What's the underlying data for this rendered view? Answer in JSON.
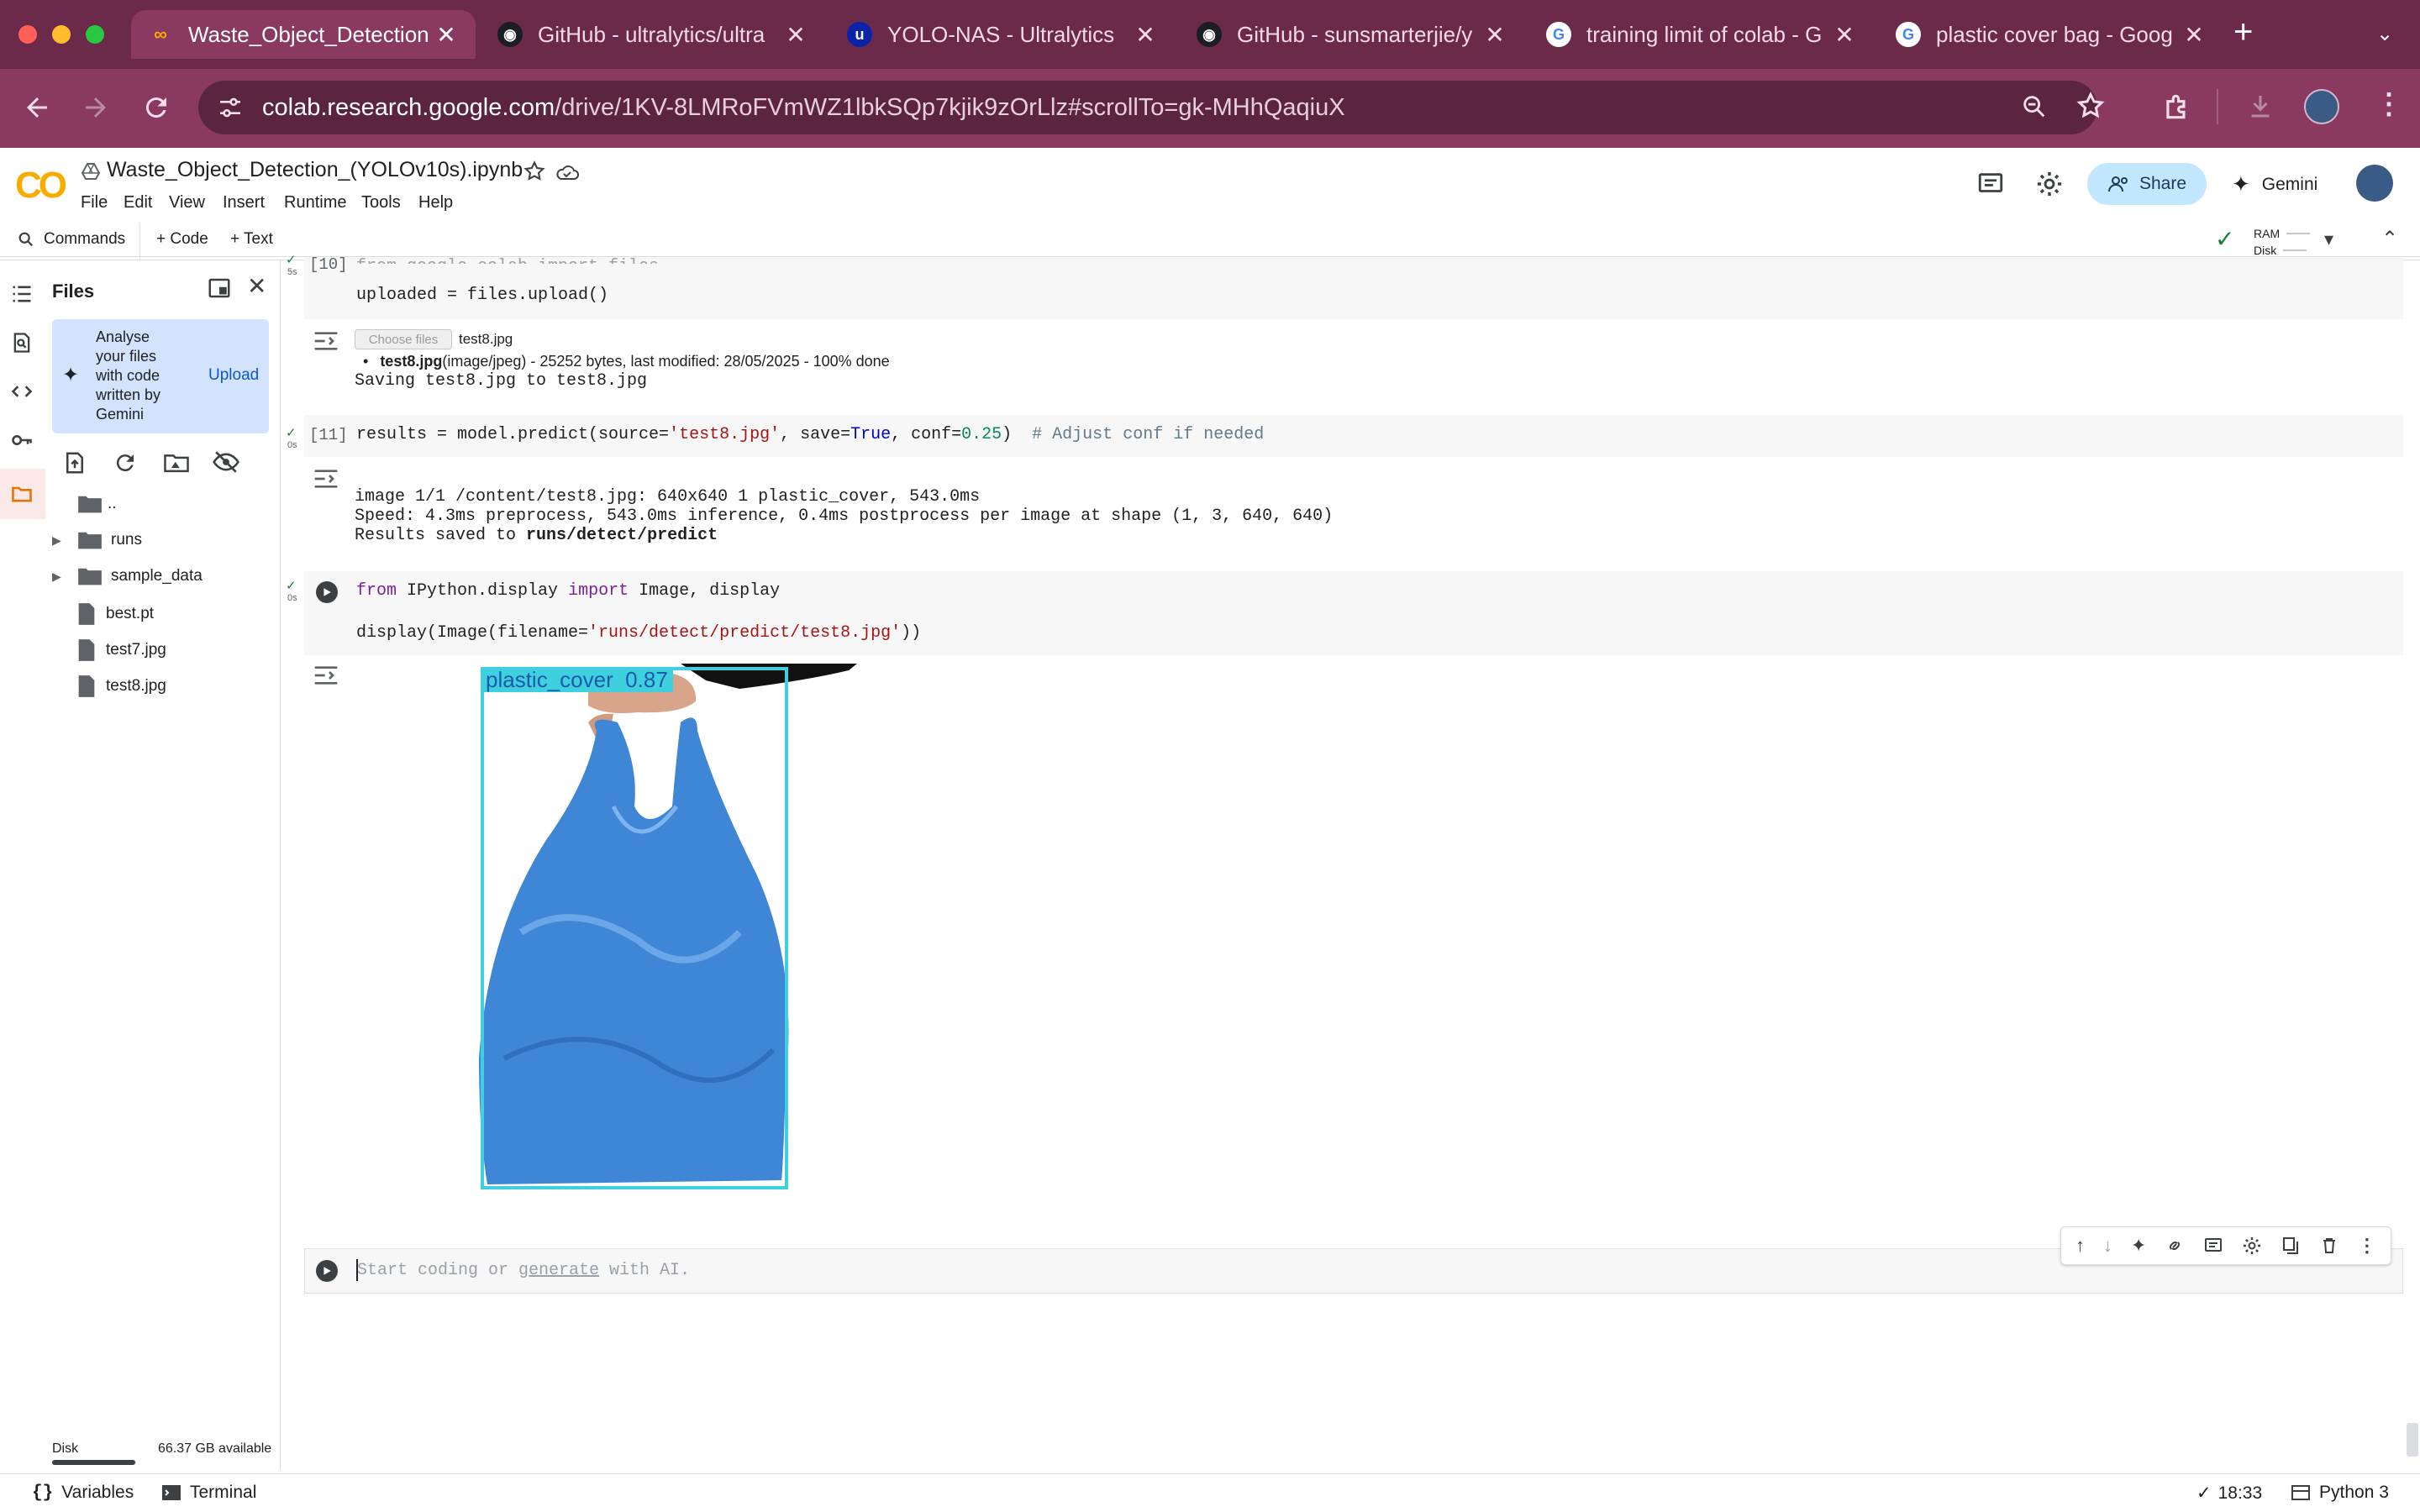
{
  "browser": {
    "tabs": [
      {
        "title": "Waste_Object_Detection",
        "icon": "colab-icon"
      },
      {
        "title": "GitHub - ultralytics/ultra",
        "icon": "github-icon"
      },
      {
        "title": "YOLO-NAS - Ultralytics",
        "icon": "ultralytics-icon"
      },
      {
        "title": "GitHub - sunsmarterjie/y",
        "icon": "github-icon"
      },
      {
        "title": "training limit of colab - G",
        "icon": "google-icon"
      },
      {
        "title": "plastic cover bag - Goog",
        "icon": "google-icon"
      }
    ],
    "url_host": "colab.research.google.com",
    "url_path": "/drive/1KV-8LMRoFVmWZ1lbkSQp7kjik9zOrLlz#scrollTo=gk-MHhQaqiuX"
  },
  "colab": {
    "notebook_title": "Waste_Object_Detection_(YOLOv10s).ipynb",
    "menus": [
      "File",
      "Edit",
      "View",
      "Insert",
      "Runtime",
      "Tools",
      "Help"
    ],
    "share_label": "Share",
    "gemini_label": "Gemini",
    "commands_label": "Commands",
    "add_code_label": "+ Code",
    "add_text_label": "+ Text",
    "ram_label": "RAM",
    "disk_label": "Disk"
  },
  "files_panel": {
    "title": "Files",
    "promo_text": "Analyse your files with code written by Gemini",
    "upload_label": "Upload",
    "tree": [
      {
        "name": "..",
        "type": "folder-up"
      },
      {
        "name": "runs",
        "type": "folder"
      },
      {
        "name": "sample_data",
        "type": "folder"
      },
      {
        "name": "best.pt",
        "type": "file"
      },
      {
        "name": "test7.jpg",
        "type": "file"
      },
      {
        "name": "test8.jpg",
        "type": "file"
      }
    ],
    "disk_label": "Disk",
    "disk_available": "66.37 GB available",
    "disk_usage_fraction": 0.99
  },
  "cells": {
    "c10": {
      "exec": "[10]",
      "time": "5s",
      "code": "uploaded = files.upload()",
      "choose_files": "Choose files",
      "chosen_file": "test8.jpg",
      "file_bold": "test8.jpg",
      "file_detail": "(image/jpeg) - 25252 bytes, last modified: 28/05/2025 - 100% done",
      "saving": "Saving test8.jpg to test8.jpg"
    },
    "c11": {
      "exec": "[11]",
      "time": "0s",
      "code_a": "results = model.predict(source=",
      "code_str": "'test8.jpg'",
      "code_b": ", save=",
      "code_true": "True",
      "code_c": ", conf=",
      "code_num": "0.25",
      "code_d": ")  ",
      "code_comment": "# Adjust conf if needed",
      "out1": "image 1/1 /content/test8.jpg: 640x640 1 plastic_cover, 543.0ms",
      "out2": "Speed: 4.3ms preprocess, 543.0ms inference, 0.4ms postprocess per image at shape (1, 3, 640, 640)",
      "out3a": "Results saved to ",
      "out3b": "runs/detect/predict"
    },
    "c12": {
      "time": "0s",
      "l1_from": "from",
      "l1_mid": " IPython.display ",
      "l1_import": "import",
      "l1_rest": " Image, display",
      "l2_a": "display(Image(filename=",
      "l2_str": "'runs/detect/predict/test8.jpg'",
      "l2_b": "))",
      "detection_label": "plastic_cover  0.87",
      "bbox_color": "#3fd0e0",
      "bag_color": "#3f86d6"
    },
    "empty": {
      "placeholder_a": "Start coding or ",
      "placeholder_link": "generate",
      "placeholder_b": " with AI."
    }
  },
  "statusbar": {
    "variables_label": "Variables",
    "terminal_label": "Terminal",
    "time": "18:33",
    "runtime": "Python 3"
  }
}
